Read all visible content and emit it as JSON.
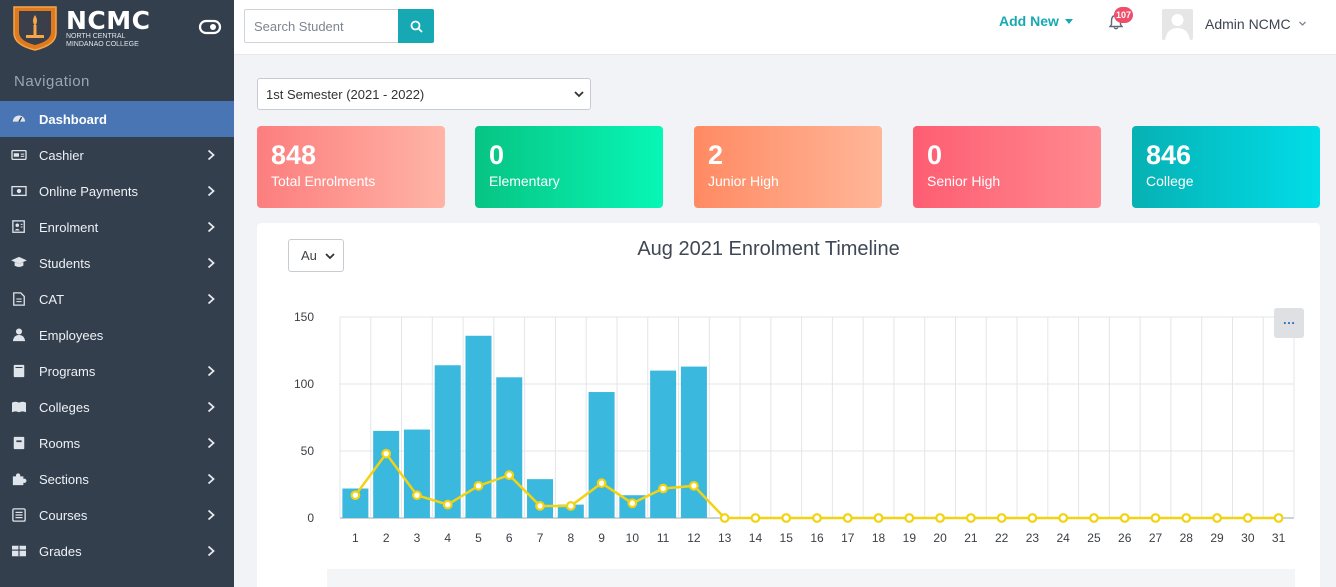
{
  "brand": {
    "name": "NCMC",
    "subtitle_line1": "North Central",
    "subtitle_line2": "Mindanao College"
  },
  "sidebar": {
    "nav_label": "Navigation",
    "items": [
      {
        "label": "Dashboard",
        "icon": "dashboard-icon",
        "active": true,
        "has_submenu": false
      },
      {
        "label": "Cashier",
        "icon": "cashier-icon",
        "active": false,
        "has_submenu": true
      },
      {
        "label": "Online Payments",
        "icon": "money-icon",
        "active": false,
        "has_submenu": true
      },
      {
        "label": "Enrolment",
        "icon": "enrolment-icon",
        "active": false,
        "has_submenu": true
      },
      {
        "label": "Students",
        "icon": "graduation-cap-icon",
        "active": false,
        "has_submenu": true
      },
      {
        "label": "CAT",
        "icon": "file-icon",
        "active": false,
        "has_submenu": true
      },
      {
        "label": "Employees",
        "icon": "user-tie-icon",
        "active": false,
        "has_submenu": false
      },
      {
        "label": "Programs",
        "icon": "book-icon",
        "active": false,
        "has_submenu": true
      },
      {
        "label": "Colleges",
        "icon": "open-book-icon",
        "active": false,
        "has_submenu": true
      },
      {
        "label": "Rooms",
        "icon": "room-icon",
        "active": false,
        "has_submenu": true
      },
      {
        "label": "Sections",
        "icon": "puzzle-icon",
        "active": false,
        "has_submenu": true
      },
      {
        "label": "Courses",
        "icon": "list-icon",
        "active": false,
        "has_submenu": true
      },
      {
        "label": "Grades",
        "icon": "table-icon",
        "active": false,
        "has_submenu": true
      }
    ]
  },
  "topbar": {
    "search_placeholder": "Search Student",
    "add_new_label": "Add New",
    "notification_count": "107",
    "user_name": "Admin NCMC"
  },
  "filters": {
    "semester": "1st Semester (2021 - 2022)",
    "month": "Au"
  },
  "stats": [
    {
      "value": "848",
      "label": "Total Enrolments",
      "gradient": [
        "#fc7e7e",
        "#ffb4a6"
      ]
    },
    {
      "value": "0",
      "label": "Elementary",
      "gradient": [
        "#07c483",
        "#07f7b6"
      ]
    },
    {
      "value": "2",
      "label": "Junior High",
      "gradient": [
        "#ff8a63",
        "#ffb698"
      ]
    },
    {
      "value": "0",
      "label": "Senior High",
      "gradient": [
        "#fe5d72",
        "#ff8a90"
      ]
    },
    {
      "value": "846",
      "label": "College",
      "gradient": [
        "#06b1b3",
        "#01dde8"
      ]
    }
  ],
  "colors": {
    "sidebar_bg": "#343f4e",
    "active_item": "#4a75b5",
    "accent": "#17a9b3",
    "bar": "#3ab8de",
    "line": "#f2d313"
  },
  "chart_data": {
    "type": "bar",
    "title": "Aug 2021 Enrolment Timeline",
    "xlabel": "",
    "ylabel": "",
    "ylim": [
      0,
      150
    ],
    "yticks": [
      0,
      50,
      100,
      150
    ],
    "grid": true,
    "categories": [
      "1",
      "2",
      "3",
      "4",
      "5",
      "6",
      "7",
      "8",
      "9",
      "10",
      "11",
      "12",
      "13",
      "14",
      "15",
      "16",
      "17",
      "18",
      "19",
      "20",
      "21",
      "22",
      "23",
      "24",
      "25",
      "26",
      "27",
      "28",
      "29",
      "30",
      "31"
    ],
    "series": [
      {
        "type": "bar",
        "values": [
          22,
          65,
          66,
          114,
          136,
          105,
          29,
          10,
          94,
          17,
          110,
          113,
          0,
          0,
          0,
          0,
          0,
          0,
          0,
          0,
          0,
          0,
          0,
          0,
          0,
          0,
          0,
          0,
          0,
          0,
          0
        ]
      },
      {
        "type": "line",
        "values": [
          17,
          48,
          17,
          10,
          24,
          32,
          9,
          9,
          26,
          11,
          22,
          24,
          0,
          0,
          0,
          0,
          0,
          0,
          0,
          0,
          0,
          0,
          0,
          0,
          0,
          0,
          0,
          0,
          0,
          0,
          0
        ]
      }
    ]
  }
}
